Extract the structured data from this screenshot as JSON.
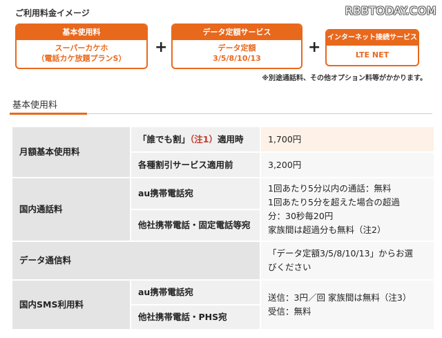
{
  "watermark": "RBBTODAY.COM",
  "summary": {
    "title": "ご利用料金イメージ",
    "boxes": [
      {
        "header": "基本使用料",
        "lines": [
          "スーパーカケホ",
          "（電話カケ放題プランS）"
        ]
      },
      {
        "header": "データ定額サービス",
        "lines": [
          "データ定額",
          "3/5/8/10/13"
        ]
      },
      {
        "header": "インターネット接続サービス",
        "lines": [
          "LTE NET"
        ]
      }
    ],
    "plus": "+",
    "note": "※別途通話料、その他オプション料等がかかります。"
  },
  "section": {
    "title": "基本使用料"
  },
  "table": {
    "monthly": {
      "label": "月額基本使用料",
      "row1_label_pre": "「誰でも割」",
      "row1_label_red": "（注1）",
      "row1_label_post": "適用時",
      "row1_value": "1,700円",
      "row2_label": "各種割引サービス適用前",
      "row2_value": "3,200円"
    },
    "domestic_call": {
      "label": "国内通話料",
      "sub1": "au携帯電話宛",
      "sub2": "他社携帯電話・固定電話等宛",
      "value_lines": [
        "1回あたり5分以内の通話：無料",
        "1回あたり5分を超えた場合の超過",
        "分：30秒毎20円",
        "家族間は超過分も無料（注2）"
      ]
    },
    "data": {
      "label": "データ通信料",
      "value_lines": [
        "「データ定額3/5/8/10/13」からお選",
        "びください"
      ]
    },
    "sms": {
      "label": "国内SMS利用料",
      "sub1": "au携帯電話宛",
      "sub2": "他社携帯電話・PHS宛",
      "value_lines": [
        "送信：3円／回 家族間は無料（注3）",
        "受信：無料"
      ]
    }
  }
}
